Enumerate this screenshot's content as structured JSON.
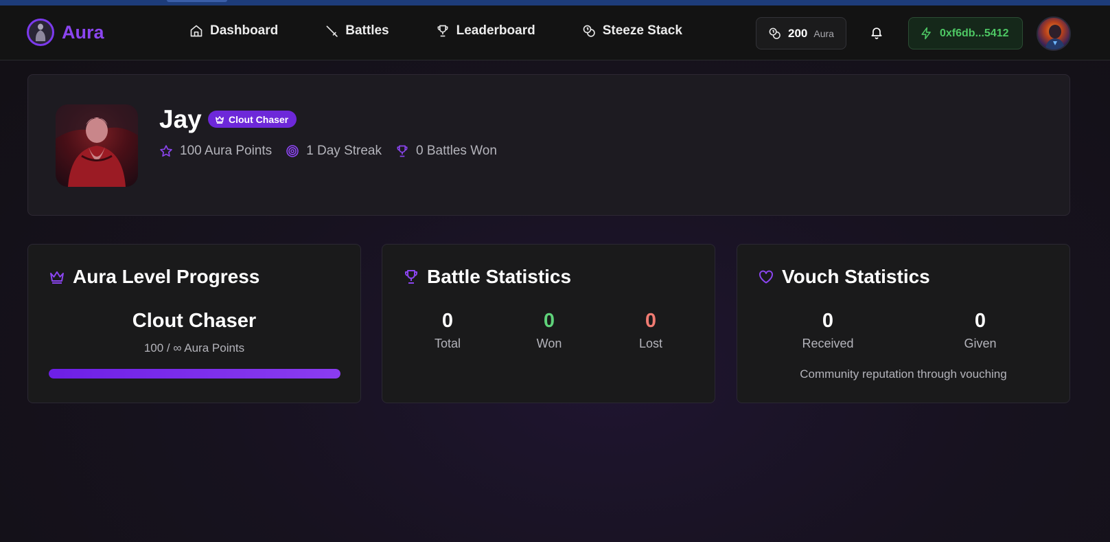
{
  "app": {
    "name": "Aura"
  },
  "nav": {
    "links": [
      {
        "label": "Dashboard",
        "icon": "home-icon"
      },
      {
        "label": "Battles",
        "icon": "sword-icon"
      },
      {
        "label": "Leaderboard",
        "icon": "trophy-icon"
      },
      {
        "label": "Steeze Stack",
        "icon": "coins-icon"
      }
    ],
    "balance": {
      "amount": "200",
      "unit": "Aura",
      "icon": "coins-icon"
    },
    "bell_icon": "bell-icon",
    "wallet": {
      "address": "0xf6db...5412",
      "icon": "lightning-icon"
    }
  },
  "profile": {
    "name": "Jay",
    "rank": "Clout Chaser",
    "aura_points": "100 Aura Points",
    "streak": "1 Day Streak",
    "battles_won": "0 Battles Won"
  },
  "level_card": {
    "title": "Aura Level Progress",
    "level_name": "Clout Chaser",
    "points_text": "100 / ∞ Aura Points",
    "progress": 1.0
  },
  "battle_card": {
    "title": "Battle Statistics",
    "total": {
      "value": "0",
      "label": "Total"
    },
    "won": {
      "value": "0",
      "label": "Won"
    },
    "lost": {
      "value": "0",
      "label": "Lost"
    }
  },
  "vouch_card": {
    "title": "Vouch Statistics",
    "received": {
      "value": "0",
      "label": "Received"
    },
    "given": {
      "value": "0",
      "label": "Given"
    },
    "note": "Community reputation through vouching"
  },
  "colors": {
    "accent": "#7c3aed",
    "won": "#5fd27a",
    "lost": "#f07b72",
    "wallet": "#4ec864"
  }
}
